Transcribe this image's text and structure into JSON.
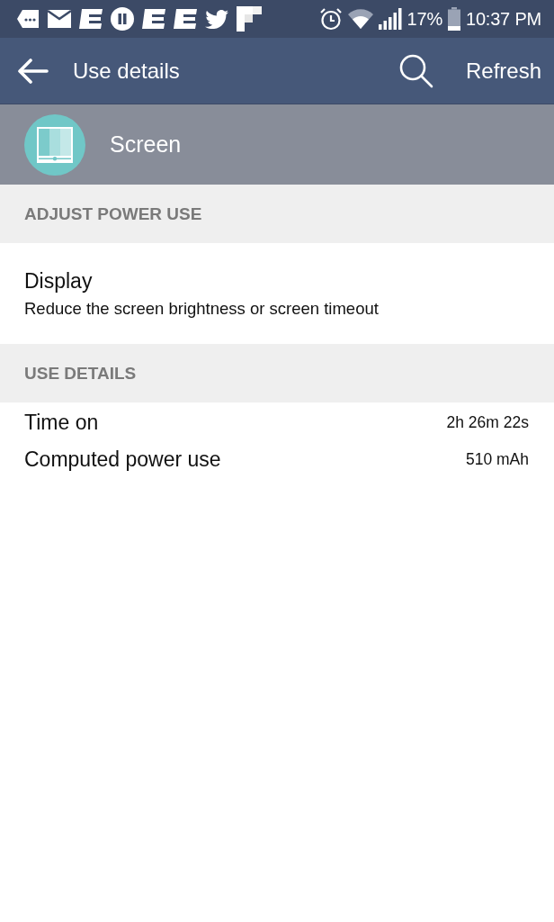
{
  "status_bar": {
    "battery_text": "17%",
    "time": "10:37 PM"
  },
  "toolbar": {
    "title": "Use details",
    "action": "Refresh"
  },
  "app_header": {
    "name": "Screen"
  },
  "sections": [
    {
      "title": "ADJUST POWER USE",
      "items": [
        {
          "kind": "setting",
          "title": "Display",
          "summary": "Reduce the screen brightness or screen timeout"
        }
      ]
    },
    {
      "title": "USE DETAILS",
      "items": [
        {
          "kind": "stat",
          "label": "Time on",
          "value": "2h 26m 22s"
        },
        {
          "kind": "stat",
          "label": "Computed power use",
          "value": "510 mAh"
        }
      ]
    }
  ]
}
